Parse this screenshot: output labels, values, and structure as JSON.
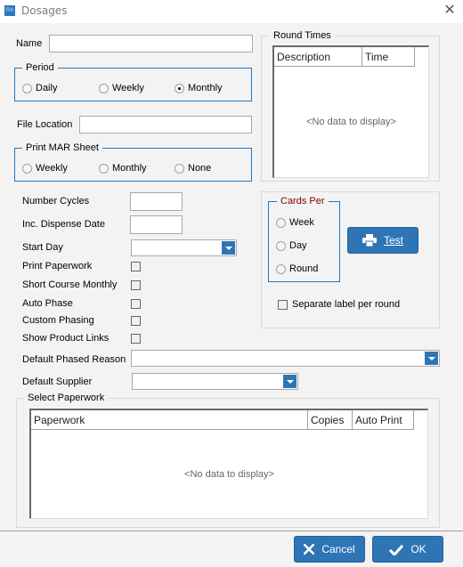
{
  "window": {
    "title": "Dosages",
    "app_icon": "rx-icon",
    "close_icon": "close-icon"
  },
  "name": {
    "label": "Name",
    "value": ""
  },
  "period": {
    "legend": "Period",
    "options": [
      {
        "label": "Daily",
        "checked": false
      },
      {
        "label": "Weekly",
        "checked": false
      },
      {
        "label": "Monthly",
        "checked": true
      }
    ]
  },
  "file_location": {
    "label": "File Location",
    "value": ""
  },
  "print_mar_sheet": {
    "legend": "Print MAR Sheet",
    "options": [
      {
        "label": "Weekly",
        "checked": false
      },
      {
        "label": "Monthly",
        "checked": false
      },
      {
        "label": "None",
        "checked": false
      }
    ]
  },
  "round_times": {
    "legend": "Round Times",
    "columns": [
      "Description",
      "Time"
    ],
    "rows": [],
    "empty_text": "<No data to display>"
  },
  "fields": {
    "number_cycles": {
      "label": "Number Cycles",
      "value": ""
    },
    "inc_dispense_date": {
      "label": "Inc. Dispense Date",
      "value": ""
    },
    "start_day": {
      "label": "Start Day",
      "value": ""
    },
    "print_paperwork": {
      "label": "Print Paperwork",
      "checked": false
    },
    "short_course_monthly": {
      "label": "Short Course Monthly",
      "checked": false
    },
    "auto_phase": {
      "label": "Auto Phase",
      "checked": false
    },
    "custom_phasing": {
      "label": "Custom Phasing",
      "checked": false
    },
    "show_product_links": {
      "label": "Show Product Links",
      "checked": false
    },
    "default_phased_reason": {
      "label": "Default Phased Reason",
      "value": ""
    },
    "default_supplier": {
      "label": "Default Supplier",
      "value": ""
    }
  },
  "cards_per": {
    "legend": "Cards Per",
    "legend_color": "#800000",
    "options": [
      {
        "label": "Week",
        "checked": false
      },
      {
        "label": "Day",
        "checked": false
      },
      {
        "label": "Round",
        "checked": false
      }
    ]
  },
  "test_button": {
    "label": "Test",
    "icon": "printer-icon"
  },
  "separate_label": {
    "label": "Separate label per round",
    "checked": false
  },
  "select_paperwork": {
    "legend": "Select Paperwork",
    "columns": [
      "Paperwork",
      "Copies",
      "Auto Print"
    ],
    "rows": [],
    "empty_text": "<No data to display>"
  },
  "footer": {
    "cancel_label": "Cancel",
    "ok_label": "OK"
  },
  "colors": {
    "accent": "#2e75b6",
    "group_border": "#1e77c8",
    "background": "#f3f3f3"
  }
}
